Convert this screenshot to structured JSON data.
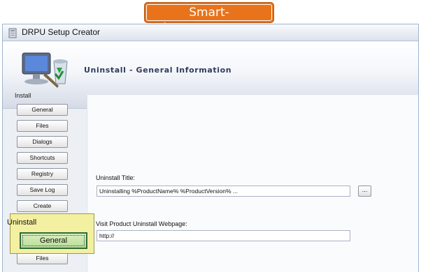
{
  "brand": {
    "text": "Smart-Accountant.com"
  },
  "window": {
    "title": "DRPU Setup Creator"
  },
  "banner": {
    "title": "Uninstall - General Information"
  },
  "sidebar": {
    "install_label": "Install",
    "install_items": [
      "General",
      "Files",
      "Dialogs",
      "Shortcuts",
      "Registry",
      "Save Log",
      "Create"
    ],
    "uninstall_label": "Uninstall",
    "uninstall_selected": "General",
    "uninstall_items_partial": [
      "Files"
    ]
  },
  "form": {
    "uninstall_title_label": "Uninstall Title:",
    "uninstall_title_value": "Uninstalling %ProductName% %ProductVersion% ...",
    "browse_label": "...",
    "webpage_label": "Visit Product Uninstall Webpage:",
    "webpage_value": "http://"
  },
  "colors": {
    "brand": "#e8731a",
    "callout": "#f4f0a2",
    "selected": "#b9dd98"
  }
}
